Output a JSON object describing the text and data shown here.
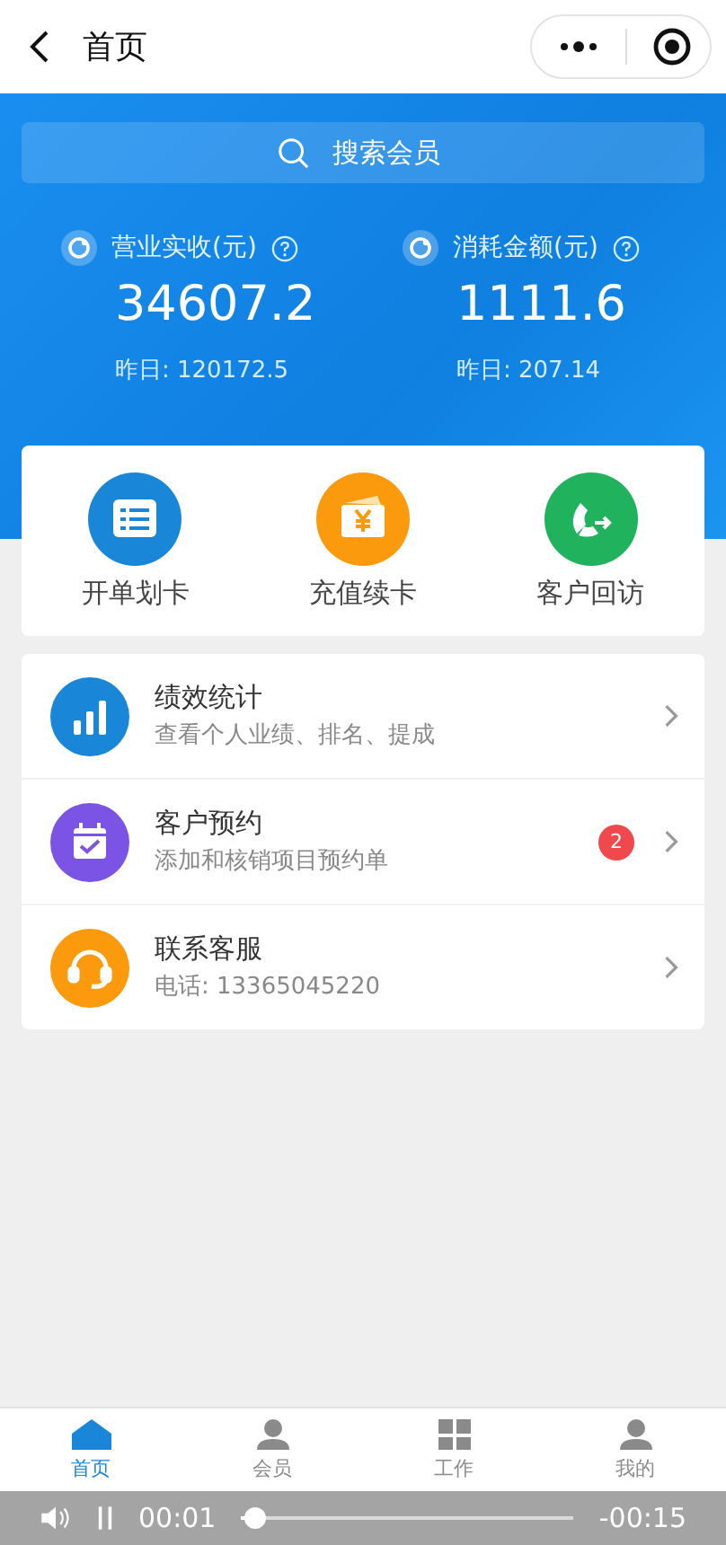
{
  "nav": {
    "title": "首页"
  },
  "search": {
    "placeholder": "搜索会员"
  },
  "stats": [
    {
      "label": "营业实收(元)",
      "value": "34607.2",
      "yesterday": "昨日: 120172.5"
    },
    {
      "label": "消耗金额(元)",
      "value": "1111.6",
      "yesterday": "昨日: 207.14"
    }
  ],
  "quick_actions": [
    {
      "label": "开单划卡",
      "kind": "bill",
      "color": "#1a86d8"
    },
    {
      "label": "充值续卡",
      "kind": "recharge",
      "color": "#fa9a0c"
    },
    {
      "label": "客户回访",
      "kind": "call",
      "color": "#21b25e"
    }
  ],
  "menu": [
    {
      "title": "绩效统计",
      "subtitle": "查看个人业绩、排名、提成",
      "kind": "stats",
      "color": "#1a86d8"
    },
    {
      "title": "客户预约",
      "subtitle": "添加和核销项目预约单",
      "kind": "calendar",
      "color": "#7b54e6",
      "badge": "2"
    },
    {
      "title": "联系客服",
      "subtitle": "电话: 13365045220",
      "kind": "support",
      "color": "#fa9a0c"
    }
  ],
  "tabs": [
    {
      "label": "首页",
      "kind": "home",
      "selected": true
    },
    {
      "label": "会员",
      "kind": "member",
      "selected": false
    },
    {
      "label": "工作",
      "kind": "work",
      "selected": false
    },
    {
      "label": "我的",
      "kind": "me",
      "selected": false
    }
  ],
  "player": {
    "elapsed": "00:01",
    "remaining": "-00:15",
    "level": 0.04
  }
}
